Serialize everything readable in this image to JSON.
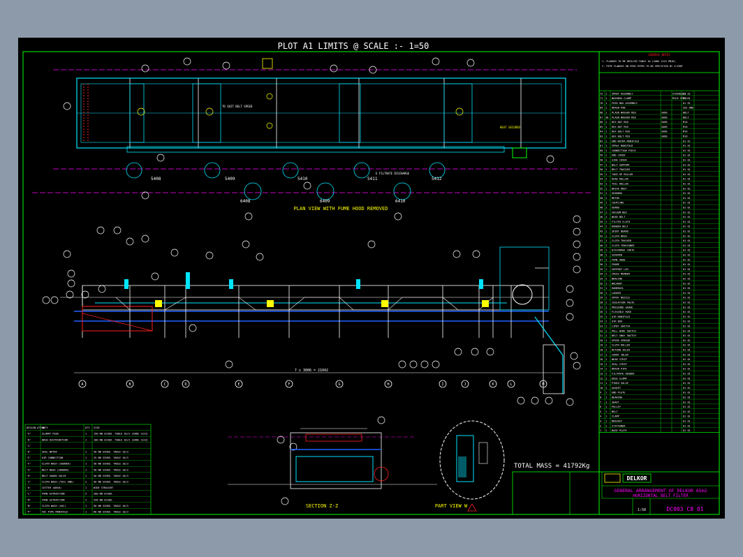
{
  "header": "PLOT A1   LIMITS @ SCALE :- 1=50",
  "plan_view": {
    "title": "PLAN VIEW WITH FUME HOOD REMOVED",
    "section_labels": [
      "5408",
      "5409",
      "5410",
      "5411",
      "5412"
    ],
    "lower_labels": [
      "6408",
      "6409",
      "6410"
    ],
    "note": "TO SUIT BELT SPEED",
    "side_note": "HEAT SECURED",
    "drain_note": "E FILTRATE DISCHARGE"
  },
  "elevation": {
    "dimension": "7 x 3006 = 21042",
    "grid_letters": [
      "A",
      "B",
      "C",
      "D",
      "E",
      "F",
      "G",
      "H",
      "I",
      "J",
      "K",
      "L",
      "M"
    ]
  },
  "section_view": {
    "title": "SECTION Z-Z"
  },
  "part_view": {
    "title": "PART VIEW W"
  },
  "total_mass": "TOTAL MASS = 41792Kg",
  "general_notes": {
    "title": "GENERAL NOTES",
    "lines": [
      "1. FLANGES TO BE DRILLED TABLE 10 (SANS 1123 PN10)",
      "2. PIPE FLANGES ON FEED PIPES TO BE SPECIFIED BY CLIENT"
    ]
  },
  "parts_list": [
    {
      "no": "72",
      "qty": "1",
      "desc": "SPRAY ASSEMBLY",
      "ref": "",
      "mat": "STAINLESS",
      "n": "01 01"
    },
    {
      "no": "71",
      "qty": "1",
      "desc": "WASHBOX CLAMP",
      "ref": "",
      "mat": "MILD STEEL",
      "n": "01 01"
    },
    {
      "no": "70",
      "qty": "1",
      "desc": "FEED BOX ASSEMBLY",
      "ref": "",
      "mat": "",
      "n": "01 01"
    },
    {
      "no": "69",
      "qty": "1",
      "desc": "DRAIN PAN",
      "ref": "",
      "mat": "",
      "n": "SEE DWG"
    },
    {
      "no": "68",
      "qty": "1",
      "desc": "PLAIN WASHER M20",
      "ref": "SANS",
      "mat": "",
      "n": "BOLT"
    },
    {
      "no": "67",
      "qty": "30",
      "desc": "PLAIN WASHER M16",
      "ref": "SANS",
      "mat": "",
      "n": "BOLT"
    },
    {
      "no": "66",
      "qty": "1",
      "desc": "HEX NUT M20",
      "ref": "SANS",
      "mat": "",
      "n": "M16"
    },
    {
      "no": "65",
      "qty": "1",
      "desc": "HEX NUT M16",
      "ref": "SANS",
      "mat": "",
      "n": "M16"
    },
    {
      "no": "64",
      "qty": "1",
      "desc": "HEX BOLT M20",
      "ref": "SANS",
      "mat": "",
      "n": "M16"
    },
    {
      "no": "63",
      "qty": "1",
      "desc": "HEX BOLT M16",
      "ref": "SANS",
      "mat": "",
      "n": "M16"
    },
    {
      "no": "62",
      "qty": "1",
      "desc": "END WATER MANIFOLD",
      "ref": "",
      "mat": "",
      "n": "01 01"
    },
    {
      "no": "61",
      "qty": "1",
      "desc": "SPRAY MANIFOLD",
      "ref": "",
      "mat": "",
      "n": "01 01"
    },
    {
      "no": "60",
      "qty": "1",
      "desc": "CONNECTION PIECE",
      "ref": "",
      "mat": "",
      "n": "01 01"
    },
    {
      "no": "59",
      "qty": "1",
      "desc": "END COVER",
      "ref": "",
      "mat": "",
      "n": "01 01"
    },
    {
      "no": "58",
      "qty": "1",
      "desc": "SIDE COVER",
      "ref": "",
      "mat": "",
      "n": "01 01"
    },
    {
      "no": "57",
      "qty": "1",
      "desc": "BELT SUPPORT",
      "ref": "",
      "mat": "",
      "n": "01 01"
    },
    {
      "no": "56",
      "qty": "1",
      "desc": "BELT TRACKER",
      "ref": "",
      "mat": "",
      "n": "01 01"
    },
    {
      "no": "55",
      "qty": "1",
      "desc": "TAKE-UP ROLLER",
      "ref": "",
      "mat": "",
      "n": "01 01"
    },
    {
      "no": "54",
      "qty": "1",
      "desc": "HEAD ROLLER",
      "ref": "",
      "mat": "",
      "n": "01 01"
    },
    {
      "no": "53",
      "qty": "1",
      "desc": "TAIL ROLLER",
      "ref": "",
      "mat": "",
      "n": "01 01"
    },
    {
      "no": "52",
      "qty": "1",
      "desc": "DRIVE UNIT",
      "ref": "",
      "mat": "",
      "n": "01 01"
    },
    {
      "no": "51",
      "qty": "1",
      "desc": "GEARBOX",
      "ref": "",
      "mat": "",
      "n": "01 01"
    },
    {
      "no": "50",
      "qty": "1",
      "desc": "MOTOR",
      "ref": "",
      "mat": "",
      "n": "01 01"
    },
    {
      "no": "49",
      "qty": "1",
      "desc": "COUPLING",
      "ref": "",
      "mat": "",
      "n": "01 01"
    },
    {
      "no": "48",
      "qty": "1",
      "desc": "GUARD",
      "ref": "",
      "mat": "",
      "n": "01 01"
    },
    {
      "no": "47",
      "qty": "1",
      "desc": "VACUUM BOX",
      "ref": "",
      "mat": "",
      "n": "01 01"
    },
    {
      "no": "46",
      "qty": "1",
      "desc": "WEAR BELT",
      "ref": "",
      "mat": "",
      "n": "01 01"
    },
    {
      "no": "45",
      "qty": "1",
      "desc": "FILTER CLOTH",
      "ref": "",
      "mat": "",
      "n": "01 01"
    },
    {
      "no": "44",
      "qty": "1",
      "desc": "RUBBER BELT",
      "ref": "",
      "mat": "",
      "n": "01 01"
    },
    {
      "no": "43",
      "qty": "1",
      "desc": "SKIRT BOARD",
      "ref": "",
      "mat": "",
      "n": "01 01"
    },
    {
      "no": "42",
      "qty": "1",
      "desc": "CLOTH WASH",
      "ref": "",
      "mat": "",
      "n": "01 01"
    },
    {
      "no": "41",
      "qty": "1",
      "desc": "CLOTH TRACKER",
      "ref": "",
      "mat": "",
      "n": "01 01"
    },
    {
      "no": "40",
      "qty": "1",
      "desc": "CLOTH TENSIONER",
      "ref": "",
      "mat": "",
      "n": "01 01"
    },
    {
      "no": "39",
      "qty": "1",
      "desc": "DISCHARGE CHUTE",
      "ref": "",
      "mat": "",
      "n": "01 01"
    },
    {
      "no": "38",
      "qty": "1",
      "desc": "SCRAPER",
      "ref": "",
      "mat": "",
      "n": "01 01"
    },
    {
      "no": "37",
      "qty": "1",
      "desc": "FUME HOOD",
      "ref": "",
      "mat": "",
      "n": "01 01"
    },
    {
      "no": "36",
      "qty": "1",
      "desc": "FRAME",
      "ref": "",
      "mat": "",
      "n": "01 01"
    },
    {
      "no": "35",
      "qty": "1",
      "desc": "SUPPORT LEG",
      "ref": "",
      "mat": "",
      "n": "01 01"
    },
    {
      "no": "34",
      "qty": "1",
      "desc": "CROSS MEMBER",
      "ref": "",
      "mat": "",
      "n": "01 01"
    },
    {
      "no": "33",
      "qty": "1",
      "desc": "BRACING",
      "ref": "",
      "mat": "",
      "n": "01 01"
    },
    {
      "no": "32",
      "qty": "1",
      "desc": "WALKWAY",
      "ref": "",
      "mat": "",
      "n": "01 01"
    },
    {
      "no": "31",
      "qty": "1",
      "desc": "HANDRAIL",
      "ref": "",
      "mat": "",
      "n": "01 01"
    },
    {
      "no": "30",
      "qty": "1",
      "desc": "LADDER",
      "ref": "",
      "mat": "",
      "n": "01 01"
    },
    {
      "no": "29",
      "qty": "1",
      "desc": "SPRAY NOZZLE",
      "ref": "",
      "mat": "",
      "n": "01 01"
    },
    {
      "no": "28",
      "qty": "1",
      "desc": "ISOLATION VALVE",
      "ref": "",
      "mat": "",
      "n": "01 01"
    },
    {
      "no": "27",
      "qty": "1",
      "desc": "PRESSURE GAUGE",
      "ref": "",
      "mat": "",
      "n": "01 01"
    },
    {
      "no": "26",
      "qty": "1",
      "desc": "FLEXIBLE HOSE",
      "ref": "",
      "mat": "",
      "n": "01 01"
    },
    {
      "no": "25",
      "qty": "1",
      "desc": "AIR MANIFOLD",
      "ref": "",
      "mat": "",
      "n": "01 01"
    },
    {
      "no": "24",
      "qty": "1",
      "desc": "AIR BOX",
      "ref": "",
      "mat": "",
      "n": "01 01"
    },
    {
      "no": "23",
      "qty": "1",
      "desc": "LIMIT SWITCH",
      "ref": "",
      "mat": "",
      "n": "01 01"
    },
    {
      "no": "22",
      "qty": "1",
      "desc": "PULL WIRE SWITCH",
      "ref": "",
      "mat": "",
      "n": "01 01"
    },
    {
      "no": "21",
      "qty": "1",
      "desc": "BELT SWAY SWITCH",
      "ref": "",
      "mat": "",
      "n": "01 01"
    },
    {
      "no": "20",
      "qty": "1",
      "desc": "SPEED SENSOR",
      "ref": "",
      "mat": "",
      "n": "01 01"
    },
    {
      "no": "19",
      "qty": "1",
      "desc": "CLOTH ROLLER",
      "ref": "",
      "mat": "",
      "n": "01 01"
    },
    {
      "no": "18",
      "qty": "1",
      "desc": "RETURN IDLER",
      "ref": "",
      "mat": "",
      "n": "01 01"
    },
    {
      "no": "17",
      "qty": "1",
      "desc": "CARRY IDLER",
      "ref": "",
      "mat": "",
      "n": "01 01"
    },
    {
      "no": "16",
      "qty": "1",
      "desc": "WEAR STRIP",
      "ref": "",
      "mat": "",
      "n": "01 01"
    },
    {
      "no": "15",
      "qty": "1",
      "desc": "SEAL STRIP",
      "ref": "",
      "mat": "",
      "n": "01 01"
    },
    {
      "no": "14",
      "qty": "1",
      "desc": "DRAIN PIPE",
      "ref": "",
      "mat": "",
      "n": "01 01"
    },
    {
      "no": "13",
      "qty": "1",
      "desc": "FILTRATE HEADER",
      "ref": "",
      "mat": "",
      "n": "01 01"
    },
    {
      "no": "12",
      "qty": "1",
      "desc": "HOSE CLAMP",
      "ref": "",
      "mat": "",
      "n": "01 01"
    },
    {
      "no": "11",
      "qty": "1",
      "desc": "PINCH VALVE",
      "ref": "",
      "mat": "",
      "n": "01 01"
    },
    {
      "no": "10",
      "qty": "1",
      "desc": "GASKET",
      "ref": "",
      "mat": "",
      "n": "01 01"
    },
    {
      "no": "9",
      "qty": "1",
      "desc": "END PLATE",
      "ref": "",
      "mat": "",
      "n": "01 01"
    },
    {
      "no": "8",
      "qty": "1",
      "desc": "BEARING",
      "ref": "",
      "mat": "",
      "n": "01 01"
    },
    {
      "no": "7",
      "qty": "1",
      "desc": "SHAFT",
      "ref": "",
      "mat": "",
      "n": "01 01"
    },
    {
      "no": "6",
      "qty": "1",
      "desc": "PULLEY",
      "ref": "",
      "mat": "",
      "n": "01 01"
    },
    {
      "no": "5",
      "qty": "1",
      "desc": "BELT",
      "ref": "",
      "mat": "",
      "n": "01 01"
    },
    {
      "no": "4",
      "qty": "1",
      "desc": "CLAMP",
      "ref": "",
      "mat": "",
      "n": "01 01"
    },
    {
      "no": "3",
      "qty": "1",
      "desc": "BRACKET",
      "ref": "",
      "mat": "",
      "n": "01 01"
    },
    {
      "no": "2",
      "qty": "1",
      "desc": "STIFFENER",
      "ref": "",
      "mat": "",
      "n": "01 01"
    },
    {
      "no": "1",
      "qty": "1",
      "desc": "BASE PLATE",
      "ref": "",
      "mat": "",
      "n": "01 01"
    }
  ],
  "designation_table": {
    "headers": [
      "DESIGN-ATION",
      "DUTY",
      "QTY",
      "SIZE"
    ],
    "rows": [
      [
        "'A'",
        "SLURRY FEED",
        "1",
        "150 NB SCHED. TABLE 10/3 (SANS 1123)"
      ],
      [
        "'B'",
        "WASH DISTRIBUTION",
        "1",
        "100 NB SCHED. TABLE 10/3 (SANS 1123)"
      ],
      [
        "'C'",
        "",
        "",
        ""
      ],
      [
        "'D'",
        "SEAL WATER",
        "1",
        "50 NB SCHED. TABLE 10/3"
      ],
      [
        "'E'",
        "AIR CONNECTION",
        "1",
        "25 NB SCHED. TABLE 10/3"
      ],
      [
        "'F'",
        "CLOTH WASH (SHOWER)",
        "1",
        "50 NB SCHED. TABLE 10/3"
      ],
      [
        "'G'",
        "BELT WASH (SHOWER)",
        "1",
        "50 NB SCHED. TABLE 10/3"
      ],
      [
        "'H'",
        "BELT GUARD VALVE",
        "1",
        "50 NB SCHED. TABLE 10/3"
      ],
      [
        "'J'",
        "CLOTH WASH (TAIL END)",
        "2",
        "50 NB SCHED. TABLE 10/3"
      ],
      [
        "'K'",
        "CUTTER (WASH)",
        "1",
        "WIDE STRAIGHT"
      ],
      [
        "'L'",
        "FUME EXTRACTION",
        "2",
        "200 NB SCHED."
      ],
      [
        "'M'",
        "FUME EXTRACTION",
        "1",
        "250 NB SCHED."
      ],
      [
        "'N'",
        "CLOTH WASH (VAC)",
        "1",
        "50 NB SCHED. TABLE 10/3"
      ],
      [
        "'P'",
        "VAC PIPE MANIFOLD",
        "1",
        "80 NB SCHED. TABLE 10/3"
      ]
    ]
  },
  "title_block": {
    "company": "DELKOR",
    "title_line1": "GENERAL ARRANGEMENT OF DELKOR 65m2",
    "title_line2": "HORIZONTAL BELT FILTER",
    "scale": "1:50",
    "drawing_no": "DC003 C8 01"
  },
  "colors": {
    "background": "#000000",
    "frame": "#00ff00",
    "structure": "#00e5ff",
    "centerline": "#ff00ff",
    "callout": "#ffff00",
    "red": "#ff2020",
    "white": "#ffffff",
    "blue": "#2060ff"
  }
}
